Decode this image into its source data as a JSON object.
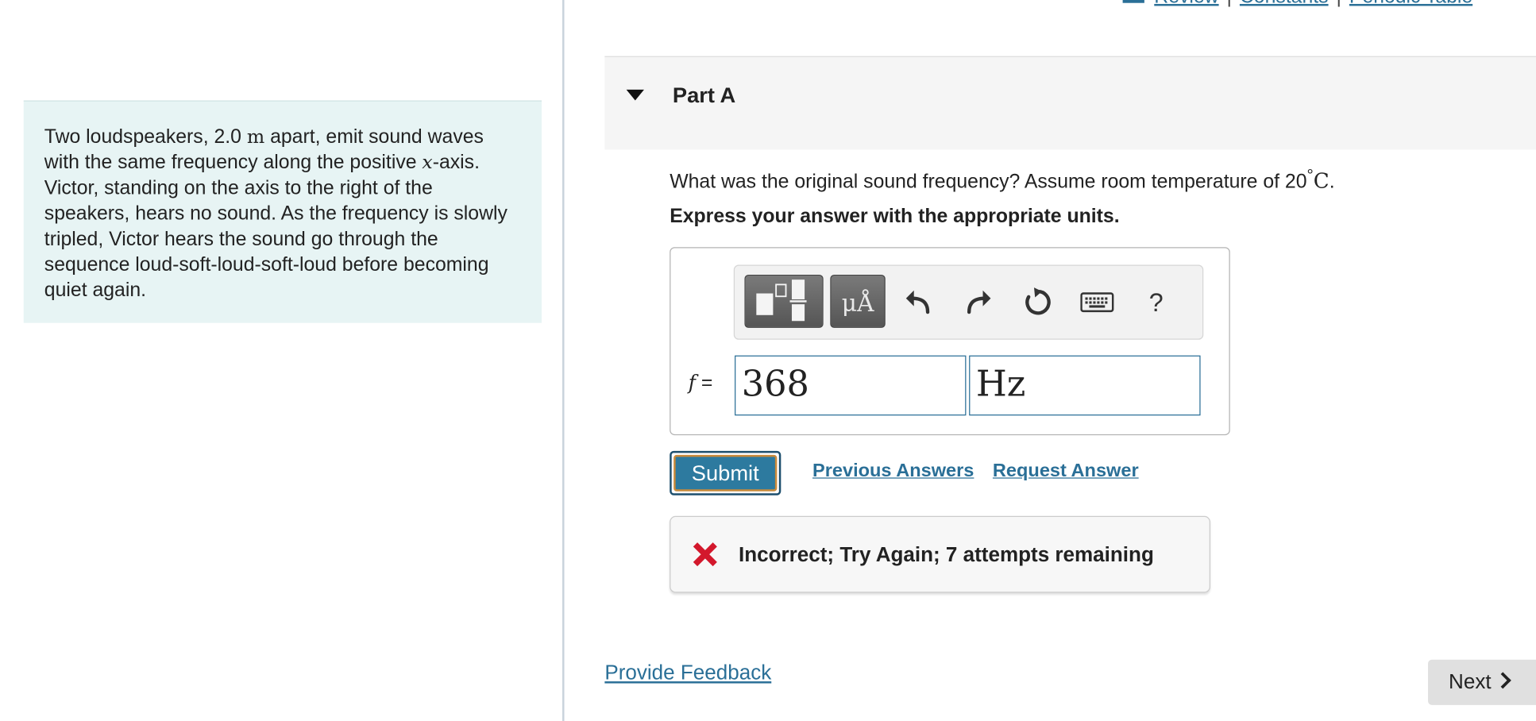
{
  "top_links": {
    "review": "Review",
    "constants": "Constants",
    "periodic_table": "Periodic Table",
    "separator": "|"
  },
  "intro": {
    "seg1": "Two loudspeakers, 2.0 ",
    "unit_m": "m",
    "seg2": " apart, emit sound waves with the same frequency along the positive ",
    "var_x": "x",
    "seg3": "-axis. Victor, standing on the axis to the right of the speakers, hears no sound. As the frequency is slowly tripled, Victor hears the sound go through the sequence loud-soft-loud-soft-loud before becoming quiet again."
  },
  "part": {
    "title": "Part A"
  },
  "question": {
    "text": "What was the original sound frequency? Assume room temperature of 20",
    "degree": "°",
    "unit_c": "C",
    "end": ".",
    "instruction": "Express your answer with the appropriate units."
  },
  "toolbar": {
    "units_button_label": "μÅ",
    "help_label": "?"
  },
  "answer": {
    "variable": "f",
    "equals": "=",
    "value": "368",
    "units": "Hz"
  },
  "actions": {
    "submit_label": "Submit",
    "previous_answers": "Previous Answers",
    "request_answer": "Request Answer"
  },
  "feedback": {
    "message": "Incorrect; Try Again; 7 attempts remaining",
    "status_color": "#d3182c"
  },
  "footer": {
    "provide_feedback": "Provide Feedback",
    "next_label": "Next"
  }
}
